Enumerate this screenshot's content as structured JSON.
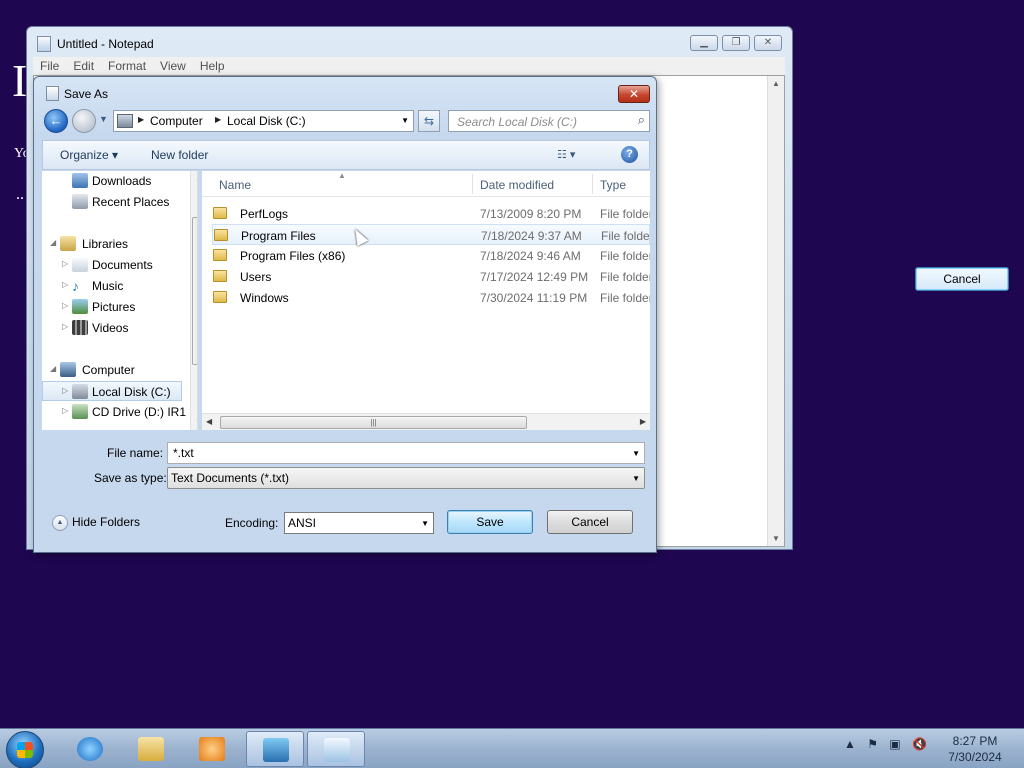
{
  "background": {
    "big_text": "I",
    "small_text": "Yo",
    "dots": "..",
    "cancel_label": "Cancel"
  },
  "notepad": {
    "title": "Untitled - Notepad",
    "menu": [
      "File",
      "Edit",
      "Format",
      "View",
      "Help"
    ]
  },
  "dialog": {
    "title": "Save As",
    "close_glyph": "✕",
    "breadcrumb": [
      "Computer",
      "Local Disk (C:)"
    ],
    "search_placeholder": "Search Local Disk (C:)",
    "toolbar": {
      "organize": "Organize ▾",
      "new_folder": "New folder"
    },
    "nav_items": [
      {
        "label": "Downloads",
        "icon": "downloads-icon",
        "indent": 1
      },
      {
        "label": "Recent Places",
        "icon": "recent-places-icon",
        "indent": 1
      },
      {
        "label": "Libraries",
        "icon": "libraries-icon",
        "indent": 0
      },
      {
        "label": "Documents",
        "icon": "documents-icon",
        "indent": 1
      },
      {
        "label": "Music",
        "icon": "music-icon",
        "indent": 1
      },
      {
        "label": "Pictures",
        "icon": "pictures-icon",
        "indent": 1
      },
      {
        "label": "Videos",
        "icon": "videos-icon",
        "indent": 1
      },
      {
        "label": "Computer",
        "icon": "computer-icon",
        "indent": 0
      },
      {
        "label": "Local Disk (C:)",
        "icon": "local-disk-icon",
        "indent": 1,
        "selected": true
      },
      {
        "label": "CD Drive (D:) IR1",
        "icon": "cd-drive-icon",
        "indent": 1
      }
    ],
    "columns": {
      "name": "Name",
      "date": "Date modified",
      "type": "Type"
    },
    "files": [
      {
        "name": "PerfLogs",
        "date": "7/13/2009 8:20 PM",
        "type": "File folder"
      },
      {
        "name": "Program Files",
        "date": "7/18/2024 9:37 AM",
        "type": "File folder"
      },
      {
        "name": "Program Files (x86)",
        "date": "7/18/2024 9:46 AM",
        "type": "File folder"
      },
      {
        "name": "Users",
        "date": "7/17/2024 12:49 PM",
        "type": "File folder"
      },
      {
        "name": "Windows",
        "date": "7/30/2024 11:19 PM",
        "type": "File folder"
      }
    ],
    "file_name_label": "File name:",
    "file_name_value": "*.txt",
    "save_as_type_label": "Save as type:",
    "save_as_type_value": "Text Documents (*.txt)",
    "hide_folders": "Hide Folders",
    "encoding_label": "Encoding:",
    "encoding_value": "ANSI",
    "save_label": "Save",
    "cancel_label": "Cancel"
  },
  "taskbar": {
    "time": "8:27 PM",
    "date": "7/30/2024"
  },
  "colors": {
    "desktop": "#1e0750",
    "taskbar": "#9cb3cf"
  }
}
